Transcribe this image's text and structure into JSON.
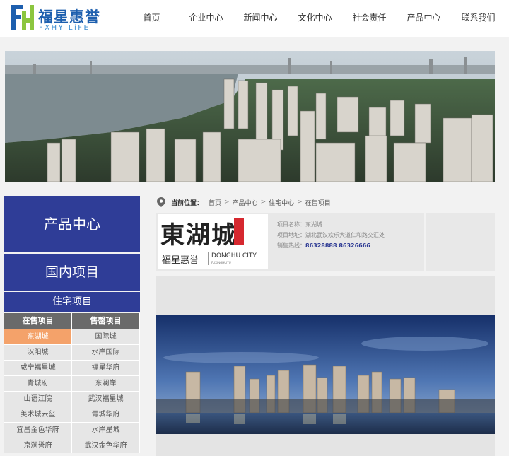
{
  "brand": {
    "name_cn": "福星惠誉",
    "name_en": "FXHY LiFE",
    "mark": "FH",
    "color_blue": "#1d5fae",
    "color_green": "#8cc63f"
  },
  "nav": {
    "items": [
      {
        "label": "首页"
      },
      {
        "label": "企业中心"
      },
      {
        "label": "新闻中心"
      },
      {
        "label": "文化中心"
      },
      {
        "label": "社会责任"
      },
      {
        "label": "产品中心"
      },
      {
        "label": "联系我们"
      }
    ]
  },
  "sidebar": {
    "title": "产品中心",
    "sub": "国内项目",
    "category": "住宅项目",
    "col_left_header": "在售项目",
    "col_right_header": "售罄项目",
    "left_items": [
      "东湖城",
      "汉阳城",
      "咸宁福星城",
      "青城府",
      "山语江院",
      "美术城云玺",
      "宜昌金色华府",
      "京澜誉府"
    ],
    "right_items": [
      "国际城",
      "水岸国际",
      "福星华府",
      "东澜岸",
      "武汉福星城",
      "青城华府",
      "水岸星城",
      "武汉金色华府"
    ],
    "active_color": "#f4a26a",
    "primary_color": "#2f3d97"
  },
  "breadcrumb": {
    "label": "当前位置：",
    "items": [
      "首页",
      "产品中心",
      "住宅中心",
      "在售项目"
    ],
    "sep": ">"
  },
  "project": {
    "logo_cn_big": "東湖城",
    "logo_brand": "福星惠誉",
    "logo_en": "DONGHU CITY",
    "logo_en_small": "FUXINGHUIYU",
    "name_label": "项目名称：",
    "name_value": "东湖城",
    "addr_label": "项目地址：",
    "addr_value": "湖北武汉欢乐大道仁和路交汇处",
    "tel_label": "销售热线：",
    "tel_value": "86328888  86326666"
  }
}
